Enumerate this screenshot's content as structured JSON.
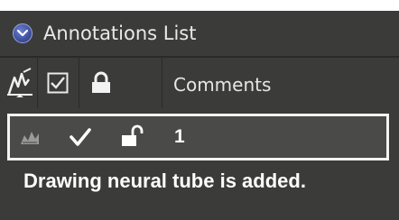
{
  "panel": {
    "title": "Annotations List"
  },
  "columns": {
    "comments_label": "Comments"
  },
  "rows": [
    {
      "id": "1",
      "checked": true,
      "locked": false
    }
  ],
  "caption": "Drawing neural tube is added.",
  "icons": {
    "collapse": "chevron-down-icon",
    "drawing_column": "drawing-icon",
    "checkbox_column": "checkbox-icon",
    "lock_column": "lock-icon",
    "row_drawing": "drawing-icon",
    "row_check": "checkmark-icon",
    "row_lock": "unlock-icon"
  },
  "colors": {
    "panel_bg": "#3b3c3a",
    "row_selected_bg": "#4a4b48",
    "selection_border": "#f3f3f3",
    "accent_blue": "#3e4f9e"
  }
}
